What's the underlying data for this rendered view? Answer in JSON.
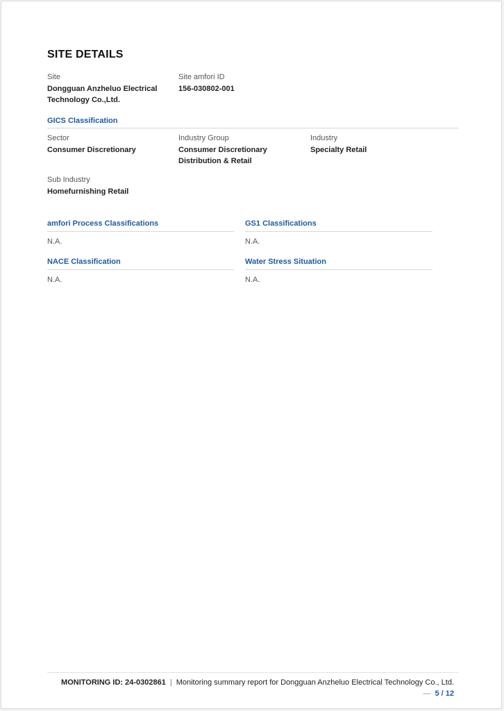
{
  "heading": "SITE DETAILS",
  "site": {
    "site_label": "Site",
    "site_value_line1": "Dongguan Anzheluo Electrical",
    "site_value_line2": "Technology Co.,Ltd.",
    "id_label": "Site amfori ID",
    "id_value": "156-030802-001"
  },
  "gics": {
    "title": "GICS Classification",
    "sector_label": "Sector",
    "sector_value": "Consumer Discretionary",
    "group_label": "Industry Group",
    "group_value_line1": "Consumer Discretionary",
    "group_value_line2": "Distribution & Retail",
    "industry_label": "Industry",
    "industry_value": "Specialty Retail",
    "sub_label": "Sub Industry",
    "sub_value": "Homefurnishing Retail"
  },
  "classifications": {
    "process_title": "amfori Process Classifications",
    "process_value": "N.A.",
    "gs1_title": "GS1 Classifications",
    "gs1_value": "N.A.",
    "nace_title": "NACE Classification",
    "nace_value": "N.A.",
    "water_title": "Water Stress Situation",
    "water_value": "N.A."
  },
  "footer": {
    "monitoring_id": "MONITORING ID: 24-0302861",
    "separator": "|",
    "report_text": "Monitoring summary report for Dongguan Anzheluo Electrical Technology Co., Ltd.",
    "dash": "—",
    "page": "5 / 12"
  }
}
